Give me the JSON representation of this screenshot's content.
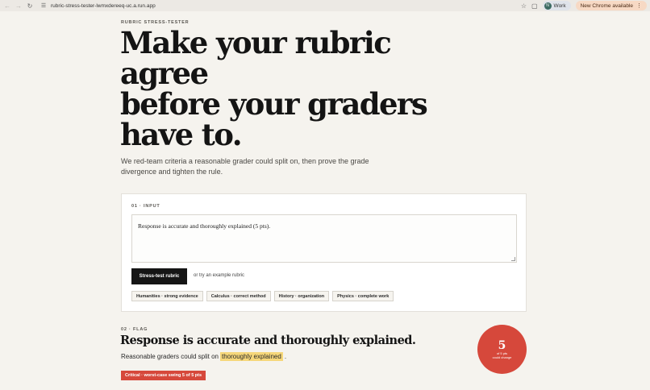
{
  "browser": {
    "url": "rubric-stress-tester-lwmxdereeq-uc.a.run.app",
    "profile_label": "Work",
    "profile_initial": "N",
    "update_label": "New Chrome available"
  },
  "page": {
    "eyebrow": "RUBRIC STRESS-TESTER",
    "hero_lines": [
      "Make your rubric",
      "agree",
      "before your graders",
      "have to."
    ],
    "lede": "We red-team criteria a reasonable grader could split on, then prove the grade divergence and tighten the rule."
  },
  "input_card": {
    "step_label": "01 · INPUT",
    "rubric_text": "Response is accurate and thoroughly explained (5 pts).",
    "run_button": "Stress-test rubric",
    "or_text": "or try an example rubric",
    "examples": [
      "Humanities · strong evidence",
      "Calculus · correct method",
      "History · organization",
      "Physics · complete work"
    ]
  },
  "flag": {
    "step_label": "02 · FLAG",
    "title": "Response is accurate and thoroughly explained.",
    "sub_prefix": "Reasonable graders could split on",
    "highlight": "thoroughly explained",
    "sub_suffix": ".",
    "severity": "Critical · worst-case swing 5 of 5 pts",
    "score_value": "5",
    "score_caption_1": "of 5 pts",
    "score_caption_2": "could change"
  },
  "colors": {
    "accent_red": "#d6483b",
    "highlight": "#f6d77a",
    "background": "#f5f3ee"
  }
}
